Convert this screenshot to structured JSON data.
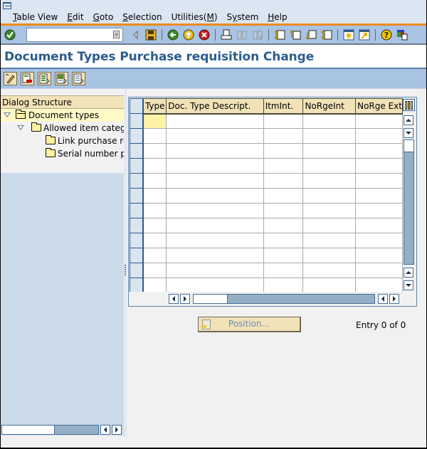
{
  "menubar": {
    "items": [
      {
        "label": "Table View",
        "mnemonic": "T"
      },
      {
        "label": "Edit",
        "mnemonic": "E"
      },
      {
        "label": "Goto",
        "mnemonic": "G"
      },
      {
        "label": "Selection",
        "mnemonic": "S"
      },
      {
        "label": "Utilities(M)",
        "mnemonic": "M"
      },
      {
        "label": "System",
        "mnemonic": "y"
      },
      {
        "label": "Help",
        "mnemonic": "H"
      }
    ]
  },
  "toolbar": {
    "command_field_value": "",
    "buttons": [
      "enter-icon",
      "back-arrow-icon",
      "save-icon",
      "back-icon",
      "exit-icon",
      "cancel-icon",
      "print-icon",
      "find-icon",
      "find-next-icon",
      "first-page-icon",
      "previous-page-icon",
      "next-page-icon",
      "last-page-icon",
      "create-session-icon",
      "shortcut-icon",
      "help-icon",
      "layout-menu-icon"
    ]
  },
  "title": "Document Types Purchase requisition Change",
  "app_toolbar": {
    "buttons": [
      "display-change-icon",
      "delete-icon",
      "select-all-icon",
      "select-block-icon",
      "deselect-all-icon"
    ]
  },
  "dialog_structure": {
    "header": "Dialog Structure",
    "nodes": [
      {
        "label": "Document types",
        "level": 0,
        "expanded": true,
        "selected": true
      },
      {
        "label": "Allowed item catego",
        "level": 1,
        "expanded": true,
        "selected": false
      },
      {
        "label": "Link purchase rec",
        "level": 2,
        "expanded": false,
        "selected": false
      },
      {
        "label": "Serial number pro",
        "level": 2,
        "expanded": false,
        "selected": false
      }
    ]
  },
  "table": {
    "columns": [
      "Type",
      "Doc. Type Descript.",
      "ItmInt.",
      "NoRgeInt",
      "NoRge Ext"
    ],
    "rows": [
      [
        "",
        "",
        "",
        "",
        ""
      ],
      [
        "",
        "",
        "",
        "",
        ""
      ],
      [
        "",
        "",
        "",
        "",
        ""
      ],
      [
        "",
        "",
        "",
        "",
        ""
      ],
      [
        "",
        "",
        "",
        "",
        ""
      ],
      [
        "",
        "",
        "",
        "",
        ""
      ],
      [
        "",
        "",
        "",
        "",
        ""
      ],
      [
        "",
        "",
        "",
        "",
        ""
      ],
      [
        "",
        "",
        "",
        "",
        ""
      ],
      [
        "",
        "",
        "",
        "",
        ""
      ],
      [
        "",
        "",
        "",
        "",
        ""
      ],
      [
        "",
        "",
        "",
        "",
        ""
      ]
    ]
  },
  "footer": {
    "position_label": "Position...",
    "entry_text": "Entry 0 of 0"
  },
  "colors": {
    "accent_orange": "#ef8a10",
    "title_blue": "#2b5d8f",
    "toolbar_blue": "#a9c3e3",
    "header_tan": "#f2e2b8",
    "focus_yellow": "#fff3a6"
  }
}
